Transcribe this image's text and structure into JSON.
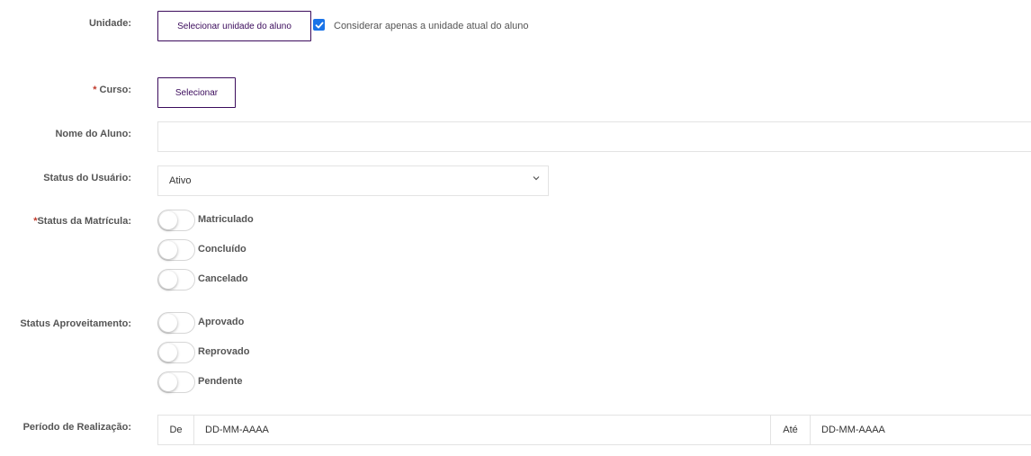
{
  "unidade": {
    "label": "Unidade:",
    "button": "Selecionar unidade do aluno",
    "checkbox_label": "Considerar apenas a unidade atual do aluno",
    "checkbox_checked": true
  },
  "curso": {
    "required_mark": "*",
    "label": " Curso:",
    "button": "Selecionar"
  },
  "nome_aluno": {
    "label": "Nome do Aluno:",
    "value": ""
  },
  "status_usuario": {
    "label": "Status do Usuário:",
    "selected": "Ativo"
  },
  "status_matricula": {
    "required_mark": "*",
    "label": "Status da Matrícula:",
    "options": [
      {
        "label": "Matriculado",
        "on": false
      },
      {
        "label": "Concluído",
        "on": false
      },
      {
        "label": "Cancelado",
        "on": false
      }
    ]
  },
  "status_aproveitamento": {
    "label": "Status Aproveitamento:",
    "options": [
      {
        "label": "Aprovado",
        "on": false
      },
      {
        "label": "Reprovado",
        "on": false
      },
      {
        "label": "Pendente",
        "on": false
      }
    ]
  },
  "periodo": {
    "label": "Período de Realização:",
    "de_label": "De",
    "de_placeholder": "DD-MM-AAAA",
    "ate_label": "Até",
    "ate_placeholder": "DD-MM-AAAA"
  },
  "colors": {
    "accent": "#3b0b5c",
    "checkbox": "#1a73e8",
    "required": "#c0392b"
  }
}
